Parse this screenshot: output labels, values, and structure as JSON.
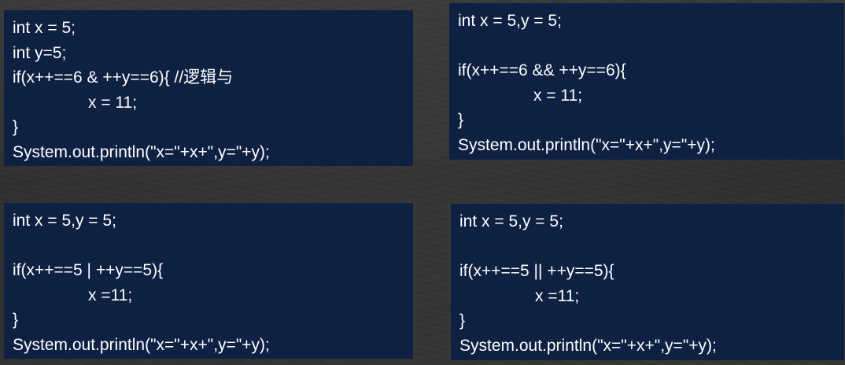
{
  "snippets": [
    {
      "lines": [
        "int x = 5;",
        "int y=5;",
        "if(x++==6 & ++y==6){ //逻辑与",
        "x = 11;",
        "}",
        "System.out.println(\"x=\"+x+\",y=\"+y);"
      ]
    },
    {
      "lines": [
        "int x = 5,y = 5;",
        "",
        "if(x++==6 && ++y==6){",
        "x = 11;",
        "}",
        "System.out.println(\"x=\"+x+\",y=\"+y);"
      ]
    },
    {
      "lines": [
        "int x = 5,y = 5;",
        "",
        "if(x++==5 | ++y==5){",
        "x =11;",
        "}",
        "System.out.println(\"x=\"+x+\",y=\"+y);"
      ]
    },
    {
      "lines": [
        "int x = 5,y = 5;",
        "",
        "if(x++==5 || ++y==5){",
        "x =11;",
        "}",
        "System.out.println(\"x=\"+x+\",y=\"+y);"
      ]
    }
  ]
}
